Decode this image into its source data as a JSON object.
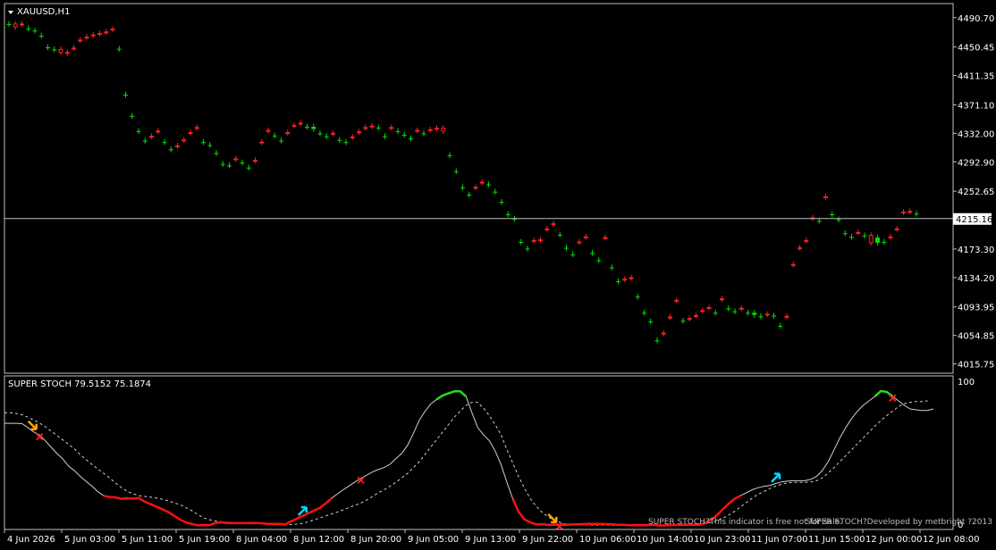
{
  "window": {
    "symbol_label": "XAUUSD,H1",
    "indicator_label": "SUPER STOCH 79.5152 75.1874",
    "current_price_label": "4215.16",
    "footer_note_1": "SUPER STOCH?This indicator is free not for sale.",
    "footer_note_2": "SUPER STOCH?Developed by metbright ?2013"
  },
  "colors": {
    "background": "#000000",
    "frame": "#c0c0c0",
    "bull_candle": "#00e000",
    "bear_candle": "#ff2020",
    "price_line": "#bfbfbf",
    "stoch_main": "#d0d0d0",
    "stoch_signal": "#d0d0d0",
    "stoch_up": "#22dd22",
    "stoch_down": "#ff1010",
    "arrow_sell": "#ffa500",
    "arrow_buy": "#00d8ff",
    "cross": "#ff2020"
  },
  "chart_data": [
    {
      "type": "candlestick",
      "title": "XAUUSD,H1",
      "ylim": [
        4003,
        4510
      ],
      "y_ticks": [
        "4490.70",
        "4450.45",
        "4411.35",
        "4371.10",
        "4332.00",
        "4292.90",
        "4252.65",
        "4213.55",
        "4173.30",
        "4134.20",
        "4093.95",
        "4054.85",
        "4015.75"
      ],
      "x_ticks": [
        "4 Jun 2026",
        "5 Jun 03:00",
        "5 Jun 11:00",
        "5 Jun 19:00",
        "8 Jun 04:00",
        "8 Jun 12:00",
        "8 Jun 20:00",
        "9 Jun 05:00",
        "9 Jun 13:00",
        "9 Jun 22:00",
        "10 Jun 06:00",
        "10 Jun 14:00",
        "10 Jun 23:00",
        "11 Jun 07:00",
        "11 Jun 15:00",
        "12 Jun 00:00",
        "12 Jun 08:00"
      ],
      "current_price": 4215.16,
      "close": [
        4482,
        4478,
        4482,
        4476,
        4473,
        4466,
        4450,
        4447,
        4443,
        4442,
        4449,
        4460,
        4464,
        4467,
        4469,
        4471,
        4475,
        4448,
        4385,
        4356,
        4335,
        4322,
        4328,
        4335,
        4320,
        4310,
        4315,
        4323,
        4333,
        4340,
        4320,
        4316,
        4305,
        4290,
        4288,
        4297,
        4292,
        4285,
        4295,
        4320,
        4336,
        4329,
        4322,
        4333,
        4343,
        4346,
        4341,
        4341,
        4332,
        4328,
        4332,
        4323,
        4320,
        4327,
        4334,
        4340,
        4342,
        4340,
        4328,
        4340,
        4335,
        4330,
        4325,
        4336,
        4332,
        4337,
        4339,
        4335,
        4302,
        4280,
        4258,
        4248,
        4258,
        4265,
        4262,
        4252,
        4238,
        4221,
        4215,
        4183,
        4174,
        4185,
        4186,
        4201,
        4208,
        4193,
        4175,
        4166,
        4183,
        4190,
        4168,
        4158,
        4189,
        4148,
        4129,
        4132,
        4134,
        4108,
        4086,
        4074,
        4048,
        4058,
        4080,
        4103,
        4075,
        4078,
        4082,
        4089,
        4093,
        4086,
        4105,
        4092,
        4088,
        4092,
        4086,
        4086,
        4081,
        4084,
        4082,
        4068,
        4081,
        4152,
        4175,
        4185,
        4216,
        4212,
        4245,
        4221,
        4214,
        4195,
        4190,
        4196,
        4192,
        4182,
        4189,
        4183,
        4190,
        4201,
        4224,
        4225,
        4222
      ],
      "up": [
        true,
        false,
        false,
        true,
        true,
        true,
        true,
        true,
        false,
        false,
        false,
        false,
        false,
        false,
        false,
        false,
        false,
        true,
        true,
        true,
        true,
        true,
        false,
        false,
        true,
        true,
        false,
        false,
        false,
        false,
        true,
        true,
        true,
        true,
        true,
        false,
        true,
        true,
        false,
        false,
        false,
        true,
        true,
        false,
        false,
        false,
        true,
        true,
        true,
        true,
        false,
        true,
        true,
        false,
        false,
        false,
        false,
        true,
        true,
        false,
        true,
        true,
        true,
        false,
        true,
        false,
        false,
        false,
        true,
        true,
        true,
        true,
        false,
        false,
        true,
        true,
        true,
        true,
        true,
        true,
        true,
        false,
        false,
        false,
        false,
        true,
        true,
        true,
        false,
        false,
        true,
        true,
        false,
        true,
        true,
        false,
        false,
        true,
        true,
        true,
        true,
        false,
        false,
        false,
        true,
        false,
        false,
        false,
        false,
        true,
        false,
        true,
        true,
        false,
        true,
        true,
        true,
        false,
        true,
        true,
        false,
        false,
        false,
        false,
        false,
        true,
        false,
        true,
        true,
        true,
        true,
        false,
        true,
        false,
        true,
        true,
        false,
        false,
        false,
        false,
        true
      ]
    },
    {
      "type": "line",
      "title": "SUPER STOCH",
      "ylim": [
        0,
        100
      ],
      "y_ticks": [
        "100",
        "0"
      ],
      "main_values": [
        79.52
      ],
      "signal_values": [
        75.19
      ],
      "main_series": [
        69.8,
        69.8,
        69.8,
        69.6,
        67.0,
        64.0,
        62.0,
        58.0,
        53.6,
        49.4,
        45.7,
        40.8,
        37.8,
        34.0,
        30.5,
        27.4,
        23.6,
        20.9,
        20.0,
        19.8,
        18.9,
        19.2,
        19.0,
        19.4,
        17.0,
        15.3,
        13.6,
        11.8,
        10.0,
        7.6,
        5.0,
        3.0,
        2.0,
        1.0,
        1.0,
        1.0,
        2.4,
        3.0,
        2.6,
        2.5,
        2.5,
        2.5,
        2.6,
        2.5,
        2.4,
        2.0,
        2.0,
        2.0,
        1.5,
        3.6,
        5.4,
        7.3,
        9.1,
        11.0,
        12.8,
        15.8,
        19.3,
        22.2,
        25.0,
        27.6,
        30.3,
        32.6,
        34.8,
        37.0,
        38.6,
        40.0,
        42.2,
        46.0,
        49.5,
        55.0,
        63.0,
        72.0,
        78.0,
        83.0,
        86.0,
        88.6,
        90.0,
        91.4,
        91.4,
        88.0,
        77.0,
        67.0,
        62.0,
        58.0,
        51.0,
        42.0,
        30.0,
        19.0,
        10.0,
        5.0,
        3.0,
        1.6,
        1.6,
        1.3,
        1.3,
        1.4,
        1.4,
        1.5,
        1.6,
        1.8,
        2.0,
        1.9,
        2.0,
        1.8,
        1.7,
        1.3,
        1.3,
        1.1,
        1.0,
        1.0,
        1.1,
        1.3,
        0.9,
        0.9,
        1.2,
        1.2,
        1.3,
        1.4,
        1.4,
        1.4,
        2.6,
        5.0,
        8.0,
        12.0,
        15.8,
        19.0,
        21.0,
        23.0,
        25.0,
        26.4,
        27.3,
        27.9,
        29.2,
        30.3,
        30.8,
        31.1,
        31.1,
        31.1,
        32.0,
        34.0,
        38.0,
        44.0,
        52.0,
        60.0,
        67.0,
        73.0,
        78.0,
        82.0,
        85.0,
        88.0,
        91.6,
        91.0,
        88.0,
        85.0,
        82.0,
        79.5,
        79.0,
        78.5,
        78.5,
        79.5
      ],
      "signal_series": [
        77.0,
        77.0,
        76.5,
        75.6,
        74.0,
        72.0,
        70.0,
        67.5,
        64.5,
        61.6,
        58.6,
        55.6,
        52.5,
        48.5,
        45.3,
        42.0,
        39.0,
        36.0,
        33.0,
        29.5,
        26.5,
        24.0,
        22.3,
        21.0,
        20.5,
        20.0,
        19.4,
        18.6,
        17.6,
        16.2,
        15.0,
        13.0,
        11.0,
        8.5,
        6.2,
        4.8,
        4.0,
        3.5,
        3.0,
        2.8,
        2.5,
        2.3,
        2.2,
        2.1,
        2.0,
        1.9,
        1.8,
        1.6,
        1.5,
        1.5,
        1.8,
        2.2,
        3.4,
        4.7,
        6.0,
        7.4,
        8.7,
        10.0,
        11.5,
        13.0,
        14.5,
        16.0,
        18.0,
        20.5,
        23.0,
        25.0,
        27.5,
        30.0,
        33.0,
        36.0,
        40.0,
        44.0,
        49.0,
        54.0,
        59.0,
        64.0,
        69.0,
        74.0,
        78.0,
        82.0,
        84.0,
        84.0,
        80.0,
        75.0,
        69.0,
        62.0,
        52.0,
        43.0,
        34.0,
        26.0,
        19.0,
        14.0,
        9.8,
        6.8,
        4.6,
        3.0,
        2.0,
        1.6,
        1.4,
        1.3,
        1.3,
        1.2,
        1.2,
        1.2,
        1.1,
        1.0,
        1.0,
        1.0,
        1.0,
        1.0,
        1.0,
        1.0,
        1.0,
        1.0,
        1.0,
        1.0,
        1.2,
        1.4,
        1.6,
        1.8,
        2.2,
        3.0,
        4.2,
        5.8,
        8.0,
        10.5,
        13.5,
        16.4,
        19.4,
        22.0,
        23.8,
        25.8,
        27.4,
        28.8,
        29.6,
        30.0,
        30.0,
        30.0,
        30.2,
        31.0,
        33.0,
        36.4,
        40.0,
        44.0,
        48.0,
        52.0,
        56.0,
        60.0,
        64.0,
        68.0,
        71.6,
        75.0,
        78.0,
        81.0,
        83.0,
        84.0,
        84.5,
        84.5,
        85.0
      ],
      "sell_arrow_indices": [
        5,
        94
      ],
      "buy_arrow_indices": [
        50,
        131
      ],
      "cross_indices": [
        6,
        61,
        95,
        152
      ]
    }
  ]
}
